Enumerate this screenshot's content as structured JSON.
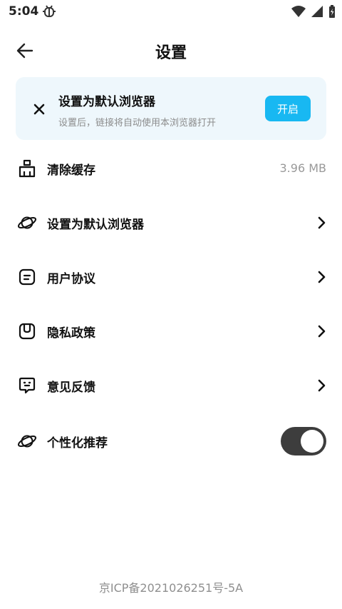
{
  "status": {
    "time": "5:04"
  },
  "header": {
    "title": "设置"
  },
  "banner": {
    "title": "设置为默认浏览器",
    "subtitle": "设置后，链接将自动使用本浏览器打开",
    "button": "开启"
  },
  "items": [
    {
      "label": "清除缓存",
      "value": "3.96 MB",
      "icon": "broom-icon"
    },
    {
      "label": "设置为默认浏览器",
      "icon": "planet-icon"
    },
    {
      "label": "用户协议",
      "icon": "document-icon"
    },
    {
      "label": "隐私政策",
      "icon": "privacy-icon"
    },
    {
      "label": "意见反馈",
      "icon": "feedback-icon"
    },
    {
      "label": "个性化推荐",
      "icon": "planet-icon",
      "toggle_on": true
    }
  ],
  "footer": {
    "text": "京ICP备2021026251号-5A"
  },
  "colors": {
    "accent": "#18b8f2",
    "banner_bg": "#eef7fc",
    "toggle_on": "#3d3d3d"
  }
}
